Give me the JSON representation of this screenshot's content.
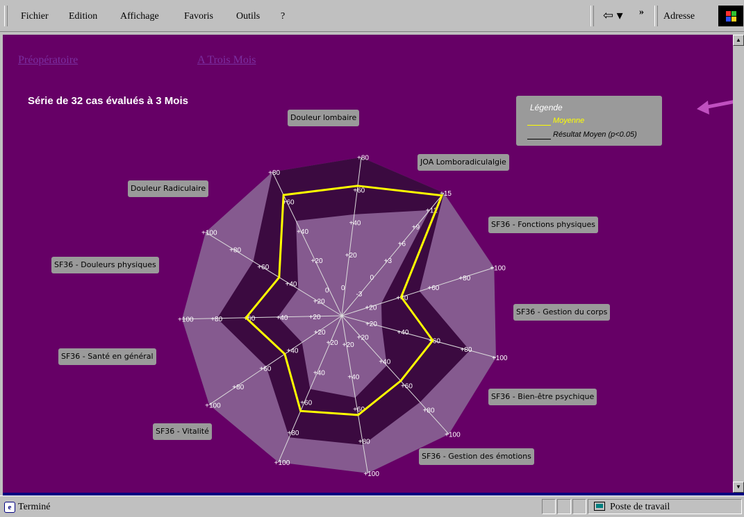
{
  "menu": {
    "fichier": "Fichier",
    "edition": "Edition",
    "affichage": "Affichage",
    "favoris": "Favoris",
    "outils": "Outils",
    "aide": "?",
    "adresse": "Adresse"
  },
  "page": {
    "link_preop": "Préopératoire",
    "link_3mois": "A Trois Mois",
    "title": "Série de 32 cas évalués à 3 Mois"
  },
  "legend": {
    "title": "Légende",
    "mean": "Moyenne",
    "result": "Résultat Moyen (p<0.05)",
    "mean_color": "#ffff00",
    "result_color": "#000000"
  },
  "axes": [
    {
      "label": "Douleur lombaire",
      "ticks": [
        "0",
        "+20",
        "+40",
        "+60",
        "+80"
      ]
    },
    {
      "label": "JOA Lomboradiculalgie",
      "ticks": [
        "-3",
        "0",
        "+3",
        "+6",
        "+9",
        "+12",
        "+15"
      ]
    },
    {
      "label": "SF36 - Fonctions physiques",
      "ticks": [
        "+20",
        "+40",
        "+60",
        "+80",
        "+100"
      ]
    },
    {
      "label": "SF36 - Gestion du corps",
      "ticks": [
        "+20",
        "+40",
        "+60",
        "+80",
        "+100"
      ]
    },
    {
      "label": "SF36 - Bien-être psychique",
      "ticks": [
        "+20",
        "+40",
        "+60",
        "+80",
        "+100"
      ]
    },
    {
      "label": "SF36 - Gestion des émotions",
      "ticks": [
        "+20",
        "+40",
        "+60",
        "+80",
        "+100"
      ]
    },
    {
      "label": "",
      "ticks": [
        "+20",
        "+40",
        "+60",
        "+80",
        "+100"
      ]
    },
    {
      "label": "SF36 - Vitalité",
      "ticks": [
        "+20",
        "+40",
        "+60",
        "+80",
        "+100"
      ]
    },
    {
      "label": "SF36 - Santé en général",
      "ticks": [
        "+20",
        "+40",
        "+60",
        "+80",
        "+100"
      ]
    },
    {
      "label": "SF36 - Douleurs physiques",
      "ticks": [
        "+20",
        "+40",
        "+60",
        "+80",
        "+100"
      ]
    },
    {
      "label": "Douleur Radiculaire",
      "ticks": [
        "0",
        "+20",
        "+40",
        "+60",
        "+80"
      ]
    }
  ],
  "chart_data": {
    "type": "radar",
    "title": "Série de 32 cas évalués à 3 Mois",
    "axes": [
      "Douleur lombaire",
      "JOA Lomboradiculalgie",
      "SF36 - Fonctions physiques",
      "SF36 - Gestion du corps",
      "SF36 - Bien-être psychique",
      "SF36 - Gestion des émotions",
      "",
      "SF36 - Vitalité",
      "SF36 - Santé en général",
      "SF36 - Douleurs physiques",
      "Douleur Radiculaire"
    ],
    "range_fraction": [
      0,
      1
    ],
    "series": [
      {
        "name": "Moyenne",
        "color": "#ffff00",
        "fraction_of_axis": [
          0.82,
          0.98,
          0.39,
          0.59,
          0.55,
          0.63,
          0.65,
          0.43,
          0.6,
          0.46,
          0.84
        ]
      },
      {
        "name": "Résultat Moyen (p<0.05)",
        "band": "dark",
        "lower": [
          0.64,
          0.86,
          0.26,
          0.26,
          0.42,
          0.52,
          0.5,
          0.3,
          0.4,
          0.32,
          0.66
        ],
        "upper": [
          1.0,
          1.0,
          0.51,
          0.83,
          0.73,
          0.82,
          0.83,
          0.57,
          0.78,
          0.65,
          1.0
        ]
      }
    ]
  },
  "status": {
    "text": "Terminé",
    "zone": "Poste de travail"
  }
}
